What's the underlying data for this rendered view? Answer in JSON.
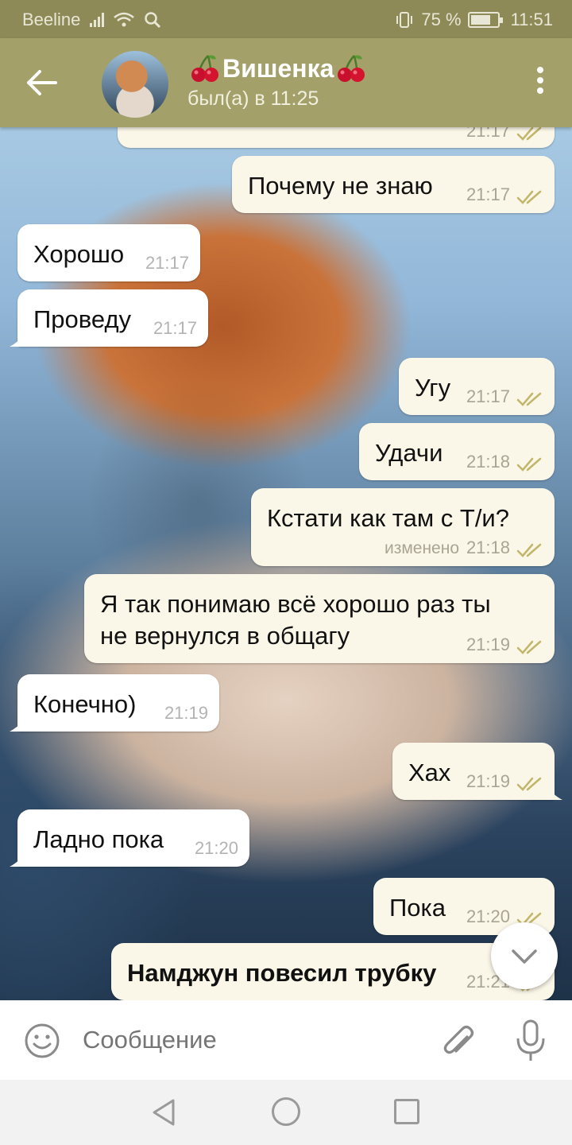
{
  "status_bar": {
    "carrier": "Beeline",
    "battery_percent": "75 %",
    "battery_level": 0.75,
    "time": "11:51"
  },
  "header": {
    "title": "Вишенка",
    "status": "был(а) в 11:25",
    "icons": [
      "back-arrow-icon",
      "cherry-icon",
      "more-vert-icon"
    ]
  },
  "messages": [
    {
      "direction": "out",
      "text": "",
      "time": "21:17",
      "read": true
    },
    {
      "direction": "out",
      "text": "Почему не знаю",
      "time": "21:17",
      "read": true
    },
    {
      "direction": "in",
      "text": "Хорошо",
      "time": "21:17"
    },
    {
      "direction": "in",
      "text": "Проведу",
      "time": "21:17"
    },
    {
      "direction": "out",
      "text": "Угу",
      "time": "21:17",
      "read": true
    },
    {
      "direction": "out",
      "text": "Удачи",
      "time": "21:18",
      "read": true
    },
    {
      "direction": "out",
      "text": "Кстати как там с Т/и?",
      "edited": "изменено",
      "time": "21:18",
      "read": true
    },
    {
      "direction": "out",
      "text": "Я так понимаю всё хорошо раз ты\nне вернулся в общагу",
      "time": "21:19",
      "read": true
    },
    {
      "direction": "in",
      "text": "Конечно)",
      "time": "21:19"
    },
    {
      "direction": "out",
      "text": "Хах",
      "time": "21:19",
      "read": true
    },
    {
      "direction": "in",
      "text": "Ладно пока",
      "time": "21:20"
    },
    {
      "direction": "out",
      "text": "Пока",
      "time": "21:20",
      "read": true
    },
    {
      "direction": "out",
      "text": "Намджун повесил трубку",
      "time": "21:21",
      "read": true
    }
  ],
  "input_bar": {
    "placeholder": "Сообщение",
    "icons": [
      "emoji-icon",
      "attach-icon",
      "mic-icon"
    ]
  },
  "colors": {
    "header": "#a3a06a",
    "status_bar": "#8e8a58",
    "outgoing_bubble": "#fbf7e8",
    "incoming_bubble": "#ffffff",
    "read_checks": "#c2b66a"
  }
}
